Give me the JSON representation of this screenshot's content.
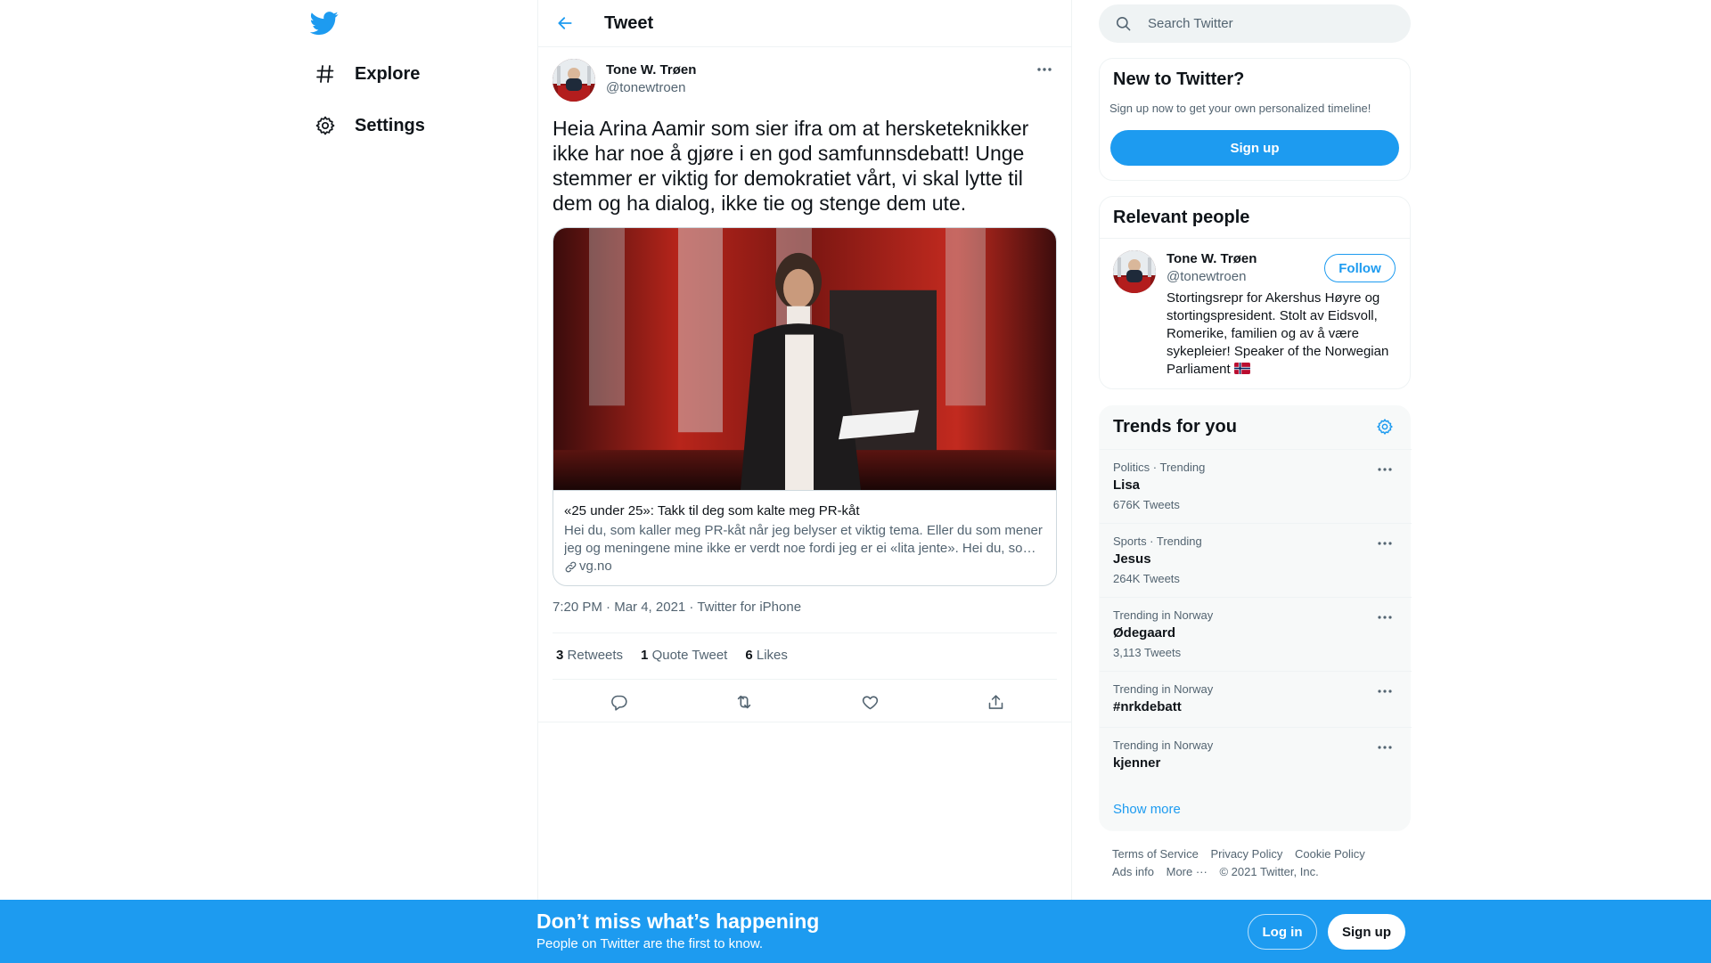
{
  "colors": {
    "accent": "#1d9bf0",
    "text": "#0f1419",
    "muted": "#536471"
  },
  "nav": {
    "logo_icon": "twitter-bird-icon",
    "items": [
      {
        "label": "Explore",
        "icon": "hashtag-icon"
      },
      {
        "label": "Settings",
        "icon": "gear-icon"
      }
    ]
  },
  "header": {
    "title": "Tweet",
    "back_icon": "back-arrow-icon"
  },
  "tweet": {
    "author_name": "Tone W. Trøen",
    "author_handle": "@tonewtroen",
    "text": "Heia Arina Aamir som sier ifra om at hersketeknikker ikke har noe å gjøre i en god samfunnsdebatt! Unge stemmer er viktig for demokratiet vårt, vi skal lytte til dem og ha dialog, ikke tie og stenge dem ute.",
    "card": {
      "title": "«25 under 25»: Takk til deg som kalte meg PR-kåt",
      "description": "Hei du, som kaller meg PR-kåt når jeg belyser et viktig tema. Eller du som mener jeg og meningene mine ikke er verdt noe fordi jeg er ei «lita jente». Hei du, so…",
      "domain": "vg.no"
    },
    "time": "7:20 PM",
    "date": "Mar 4, 2021",
    "source": "Twitter for iPhone",
    "stats": {
      "retweets_count": "3",
      "retweets_label": "Retweets",
      "quotes_count": "1",
      "quotes_label": "Quote Tweet",
      "likes_count": "6",
      "likes_label": "Likes"
    },
    "actions": [
      "reply-icon",
      "retweet-icon",
      "like-icon",
      "share-icon"
    ]
  },
  "search": {
    "placeholder": "Search Twitter"
  },
  "new_to_twitter": {
    "title": "New to Twitter?",
    "subtitle": "Sign up now to get your own personalized timeline!",
    "button": "Sign up"
  },
  "relevant_people": {
    "title": "Relevant people",
    "person": {
      "name": "Tone W. Trøen",
      "handle": "@tonewtroen",
      "follow": "Follow",
      "bio": "Stortingsrepr for Akershus Høyre og stortingspresident. Stolt av Eidsvoll, Romerike, familien og av å være sykepleier! Speaker of the Norwegian Parliament"
    }
  },
  "trends": {
    "title": "Trends for you",
    "items": [
      {
        "meta": "Politics · Trending",
        "name": "Lisa",
        "count": "676K Tweets"
      },
      {
        "meta": "Sports · Trending",
        "name": "Jesus",
        "count": "264K Tweets"
      },
      {
        "meta": "Trending in Norway",
        "name": "Ødegaard",
        "count": "3,113 Tweets"
      },
      {
        "meta": "Trending in Norway",
        "name": "#nrkdebatt",
        "count": ""
      },
      {
        "meta": "Trending in Norway",
        "name": "kjenner",
        "count": ""
      }
    ],
    "show_more": "Show more"
  },
  "footer": {
    "links": [
      "Terms of Service",
      "Privacy Policy",
      "Cookie Policy",
      "Ads info",
      "More ···"
    ],
    "copyright": "© 2021 Twitter, Inc."
  },
  "bottom_bar": {
    "title": "Don’t miss what’s happening",
    "subtitle": "People on Twitter are the first to know.",
    "login": "Log in",
    "signup": "Sign up"
  }
}
